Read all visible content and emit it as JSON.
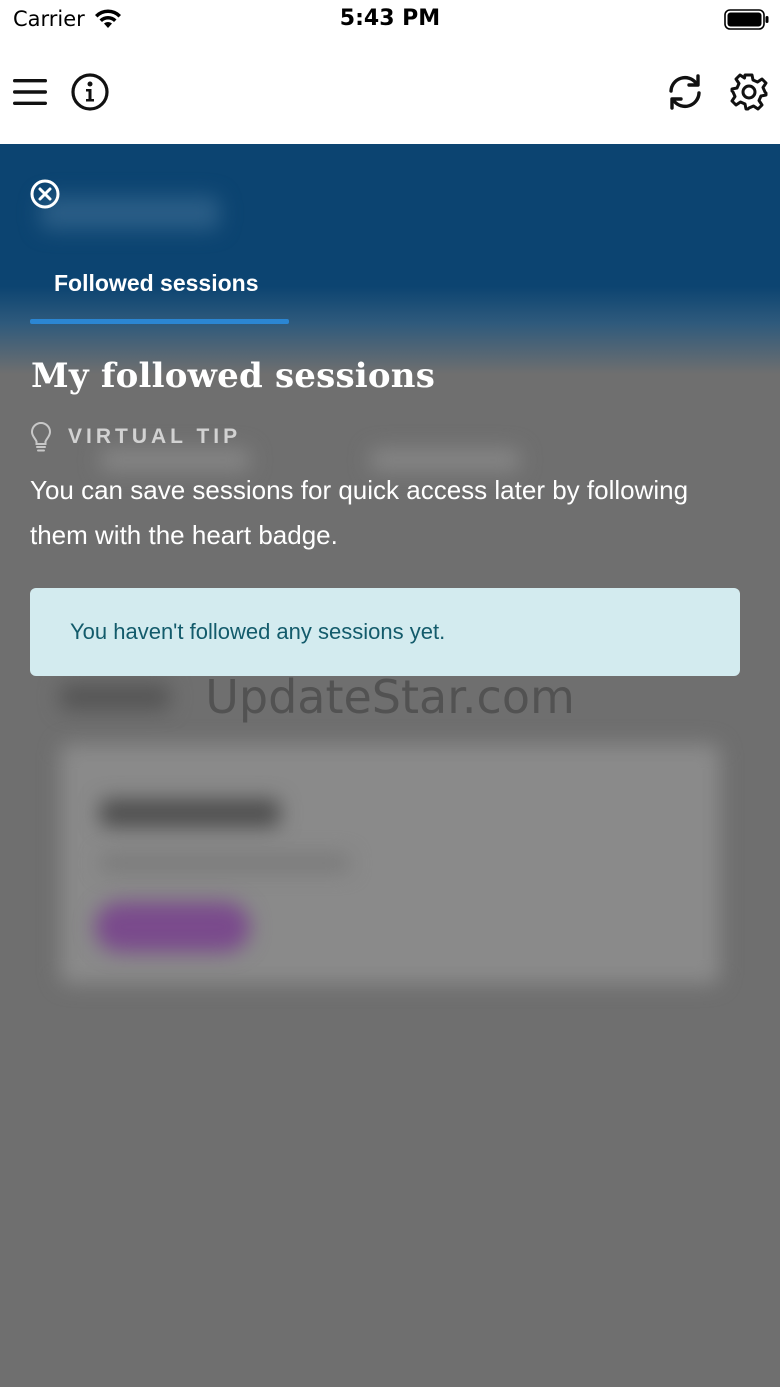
{
  "status_bar": {
    "carrier": "Carrier",
    "time": "5:43 PM",
    "icons": [
      "wifi-icon",
      "battery-icon"
    ]
  },
  "nav_bar": {
    "icons": [
      "hamburger-menu-icon",
      "info-icon",
      "refresh-icon",
      "gear-icon"
    ]
  },
  "tabs": {
    "active_label": "Followed sessions"
  },
  "main": {
    "title": "My followed sessions",
    "tip_label": "VIRTUAL TIP",
    "tip_icon": "lightbulb-icon",
    "tip_body": "You can save sessions for quick access later by following them with the heart badge.",
    "empty_message": "You haven't followed any sessions yet."
  },
  "watermark": "UpdateStar.com",
  "colors": {
    "header_blue": "#0c4471",
    "tab_underline": "#2b86d3",
    "alert_bg": "#d3ebef",
    "alert_text": "#135b6b",
    "overlay_gray": "#6f6f6f"
  }
}
